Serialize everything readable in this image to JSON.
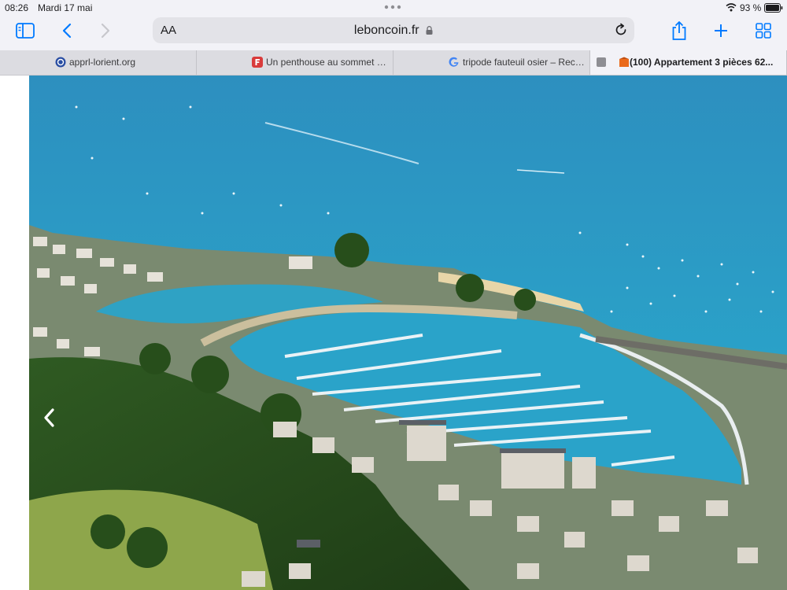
{
  "status_bar": {
    "time": "08:26",
    "date": "Mardi 17 mai",
    "battery_percent": "93 %",
    "wifi_icon": "wifi-icon",
    "battery_icon": "battery-icon"
  },
  "toolbar": {
    "text_size_label": "AA",
    "domain": "leboncoin.fr",
    "icons": [
      "sidebar-icon",
      "back-icon",
      "forward-icon",
      "lock-icon",
      "reload-icon",
      "share-icon",
      "new-tab-icon",
      "tab-overview-icon"
    ]
  },
  "tabs": [
    {
      "label": "apprl-lorient.org",
      "active": false,
      "favicon_color": "#2a4ea3"
    },
    {
      "label": "Un penthouse au sommet d’un p...",
      "active": false,
      "favicon_color": "#d93b3b"
    },
    {
      "label": "tripode fauteuil osier – Recherch...",
      "active": false,
      "favicon_color": "#4285f4"
    },
    {
      "label": "(100) Appartement 3 pièces 62...",
      "active": true,
      "favicon_color": "#ea6a1b"
    }
  ],
  "gallery": {
    "image_icon": "aerial-marina-photo",
    "prev_icon": "chevron-left-icon"
  },
  "colors": {
    "chrome_bg": "#f2f2f7",
    "accent": "#007aff",
    "sea": "#1e8fc0"
  }
}
